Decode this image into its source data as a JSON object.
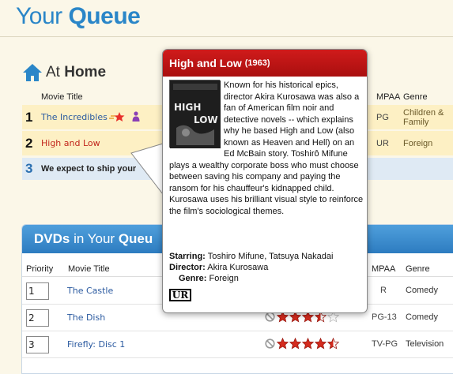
{
  "header": {
    "title_plain": "Your",
    "title_bold": "Queue"
  },
  "at_home": {
    "title_plain": "At",
    "title_bold": "Home",
    "col_title": "Movie Title",
    "col_mpaa": "MPAA",
    "col_genre": "Genre",
    "rows": [
      {
        "num": "1",
        "title": "The Incredibles",
        "mpaa": "PG",
        "genre_line1": "Children &",
        "genre_line2": "Family"
      },
      {
        "num": "2",
        "title": "High and Low",
        "mpaa": "UR",
        "genre_line1": "Foreign",
        "genre_line2": ""
      }
    ],
    "expect": {
      "num": "3",
      "text": "We expect to ship your"
    }
  },
  "dvds": {
    "title_plain_1": "DVDs",
    "title_plain_2": "in Your",
    "title_bold": "Queu",
    "col_priority": "Priority",
    "col_title": "Movie Title",
    "col_mpaa": "MPAA",
    "col_genre": "Genre",
    "rows": [
      {
        "priority": "1",
        "title": "The Castle",
        "mpaa": "R",
        "genre": "Comedy",
        "stars": 0
      },
      {
        "priority": "2",
        "title": "The Dish",
        "mpaa": "PG-13",
        "genre": "Comedy",
        "stars": 3.5
      },
      {
        "priority": "3",
        "title": "Firefly: Disc 1",
        "mpaa": "TV-PG",
        "genre": "Television",
        "stars": 4.5
      }
    ]
  },
  "popup": {
    "title": "High and Low",
    "year": "(1963)",
    "synopsis": "Known for his historical epics, director Akira Kurosawa was also a fan of American film noir and detective novels -- which explains why he based High and Low (also known as Heaven and Hell) on an Ed McBain story. Toshirô Mifune plays a wealthy corporate boss who must choose between saving his company and paying the ransom for his chauffeur's kidnapped child. Kurosawa uses his brilliant visual style to reinforce the film's sociological themes.",
    "starring_label": "Starring:",
    "starring": "Toshiro Mifune, Tatsuya Nakadai",
    "director_label": "Director:",
    "director": "Akira Kurosawa",
    "genre_label": "Genre:",
    "genre": "Foreign",
    "rating": "UR",
    "poster_text_1": "HIGH",
    "poster_text_2": "LOW"
  },
  "colors": {
    "brand_blue": "#2a86c8",
    "popup_red": "#c31515",
    "star_red": "#d42b1e"
  }
}
